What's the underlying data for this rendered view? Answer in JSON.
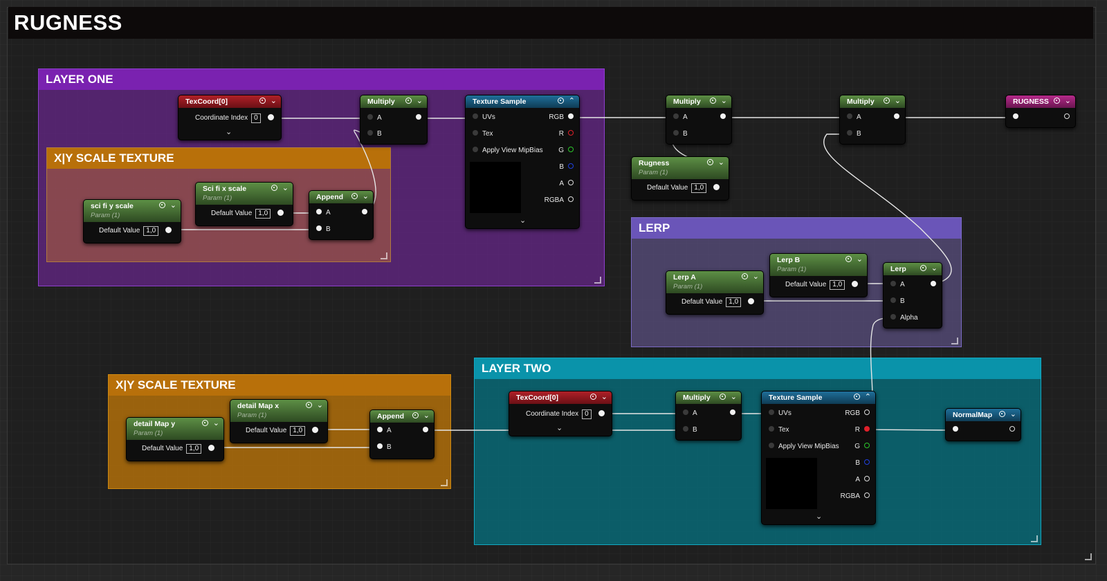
{
  "graph_title": "RUGNESS",
  "comments": {
    "layer_one": "LAYER ONE",
    "xy_scale_top": "X|Y SCALE TEXTURE",
    "lerp": "LERP",
    "xy_scale_bottom": "X|Y SCALE TEXTURE",
    "layer_two": "LAYER TWO"
  },
  "labels": {
    "param_sub": "Param (1)",
    "coordinate_index": "Coordinate Index",
    "coordinate_index_value": "0",
    "default_value": "Default Value",
    "default_value_number": "1,0",
    "pin_a": "A",
    "pin_b": "B",
    "pin_alpha": "Alpha",
    "pin_uvs": "UVs",
    "pin_tex": "Tex",
    "pin_mipbias": "Apply View MipBias",
    "pin_rgb": "RGB",
    "pin_r": "R",
    "pin_g": "G",
    "pin_b_out": "B",
    "pin_a_out": "A",
    "pin_rgba": "RGBA"
  },
  "nodes": {
    "texcoord_1": "TexCoord[0]",
    "multiply_1": "Multiply",
    "texture_sample_1": "Texture Sample",
    "multiply_2": "Multiply",
    "multiply_3": "Multiply",
    "rugness_out": "RUGNESS",
    "rugness_param": "Rugness",
    "sci_fi_x_scale": "Sci fi x scale",
    "sci_fi_y_scale": "sci fi y scale",
    "append_1": "Append",
    "lerp_a": "Lerp A",
    "lerp_b": "Lerp B",
    "lerp": "Lerp",
    "detail_map_x": "detail Map x",
    "detail_map_y": "detail Map y",
    "append_2": "Append",
    "texcoord_2": "TexCoord[0]",
    "multiply_4": "Multiply",
    "texture_sample_2": "Texture Sample",
    "normal_map": "NormalMap"
  },
  "colors": {
    "layer_one": "#7a22b0",
    "xy_scale": "#b8700a",
    "lerp": "#6a55b8",
    "layer_two": "#0a93aa"
  }
}
